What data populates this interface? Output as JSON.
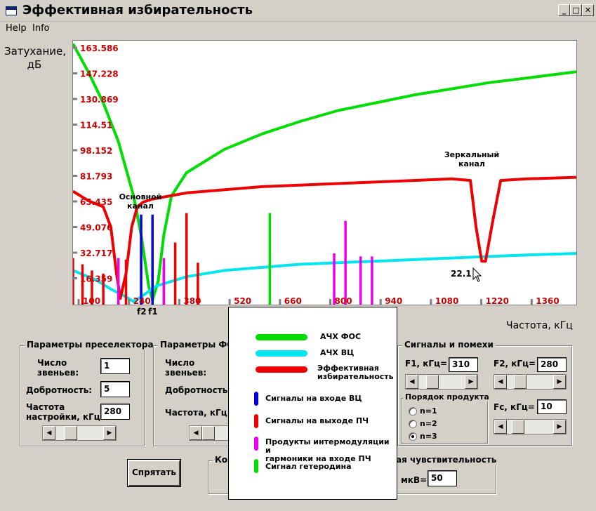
{
  "window": {
    "title": "Эффективная избирательность",
    "min": "_",
    "max": "□",
    "close": "✕"
  },
  "menu": [
    "Help",
    "Info"
  ],
  "axis": {
    "ylabel": "Затухание,\nдБ",
    "xlabel": "Частота, кГц",
    "y_ticks": [
      "163.586",
      "147.228",
      "130.869",
      "114.51",
      "98.152",
      "81.793",
      "65.435",
      "49.076",
      "32.717",
      "16.359"
    ],
    "x_ticks": [
      "100",
      "240",
      "380",
      "520",
      "660",
      "800",
      "940",
      "1080",
      "1220",
      "1360"
    ]
  },
  "chart_data": {
    "type": "line",
    "xlabel": "Частота, кГц",
    "ylabel": "Затухание, дБ",
    "xlim": [
      100,
      1430
    ],
    "ylim": [
      0,
      170
    ],
    "annotations": {
      "main_channel": "Основной\nканал",
      "mirror_channel": "Зеркальный\nканал",
      "min_value": "22.1",
      "f2": "f2",
      "f1": "f1"
    },
    "series": [
      {
        "name": "АЧХ ФОС",
        "color": "#00dd00",
        "x": [
          100,
          140,
          180,
          220,
          260,
          280,
          300,
          310,
          325,
          340,
          360,
          400,
          500,
          600,
          700,
          800,
          900,
          1000,
          1100,
          1200,
          1300,
          1430
        ],
        "y": [
          168,
          150,
          130,
          105,
          70,
          45,
          12,
          3,
          15,
          45,
          70,
          85,
          100,
          110,
          118,
          125,
          130,
          135,
          139,
          143,
          146,
          150
        ]
      },
      {
        "name": "АЧХ ВЦ",
        "color": "#00e5f0",
        "x": [
          100,
          160,
          200,
          240,
          260,
          280,
          320,
          400,
          500,
          600,
          700,
          800,
          900,
          1000,
          1100,
          1200,
          1300,
          1430
        ],
        "y": [
          22,
          16,
          10,
          5,
          2,
          5,
          12,
          18,
          22,
          24,
          26,
          27,
          28,
          29,
          30,
          31,
          32,
          33
        ]
      },
      {
        "name": "Эффективная избирательность",
        "color": "#ee0000",
        "x": [
          100,
          140,
          180,
          200,
          215,
          225,
          240,
          255,
          270,
          285,
          310,
          400,
          600,
          800,
          1000,
          1100,
          1150,
          1165,
          1180,
          1190,
          1210,
          1230,
          1300,
          1430
        ],
        "y": [
          73,
          67,
          63,
          50,
          20,
          4,
          20,
          50,
          63,
          66,
          68,
          72,
          76,
          78,
          80,
          81,
          80,
          50,
          28,
          28,
          55,
          80,
          81,
          82
        ]
      }
    ],
    "signals": [
      {
        "kind": "Сигналы на входе ВЦ",
        "color": "#0000ee",
        "x": [
          280,
          310
        ],
        "h": [
          58,
          58
        ]
      },
      {
        "kind": "Сигналы на выходе ПЧ",
        "color": "#ee0000",
        "x": [
          100,
          125,
          150,
          180,
          240,
          340,
          370,
          400,
          430
        ],
        "h": [
          30,
          26,
          22,
          20,
          29,
          25,
          40,
          59,
          27
        ]
      },
      {
        "kind": "Продукты интермодуляции и гармоники на входе ПЧ",
        "color": "#ee00ee",
        "x": [
          220,
          340,
          790,
          820,
          860,
          890
        ],
        "h": [
          30,
          30,
          33,
          54,
          31,
          31
        ]
      },
      {
        "kind": "Сигнал гетеродина",
        "color": "#00dd00",
        "x": [
          620
        ],
        "h": [
          59
        ]
      }
    ]
  },
  "preselector": {
    "title": "Параметры преселектора",
    "stages_label": "Число\nзвеньев:",
    "stages_value": "1",
    "q_label": "Добротность:",
    "q_value": "5",
    "freq_label": "Частота\nнастройки, кГц:",
    "freq_value": "280",
    "slider_pos": 0.25
  },
  "fsi": {
    "title": "Параметры ФСИ",
    "stages_label": "Число\nзвеньев:",
    "q_label": "Добротность:",
    "freq_label": "Частота, кГц:"
  },
  "signals": {
    "title": "Сигналы и помехи",
    "f1_label": "F1, кГц=",
    "f1_value": "310",
    "f1_slider": 0.22,
    "f2_label": "F2, кГц=",
    "f2_value": "280",
    "f2_slider": 0.2,
    "fc_label": "Fc, кГц=",
    "fc_value": "10",
    "fc_slider": 0.15,
    "order_title": "Порядок продукта",
    "orders": [
      "n=1",
      "n=2",
      "n=3"
    ],
    "order_selected": 2
  },
  "sensitivity": {
    "title_partial": "ая чувствительность",
    "unit": "мкВ=",
    "value": "50"
  },
  "coef": {
    "title_partial": "Коэ"
  },
  "hide_button": "Спрятать",
  "legend": {
    "items": [
      {
        "label": "АЧХ ФОС",
        "color": "#00dd00"
      },
      {
        "label": "АЧХ ВЦ",
        "color": "#00e5f0"
      },
      {
        "label": "Эффективная\nизбирательность",
        "color": "#ee0000"
      },
      {
        "label": "Сигналы на входе ВЦ",
        "color": "#0000dd"
      },
      {
        "label": "Сигналы на выходе ПЧ",
        "color": "#ee0000"
      },
      {
        "label": "Продукты интермодуляции и\nгармоники на входе ПЧ",
        "color": "#ee00ee"
      },
      {
        "label": "Сигнал гетеродина",
        "color": "#00dd00"
      }
    ]
  }
}
